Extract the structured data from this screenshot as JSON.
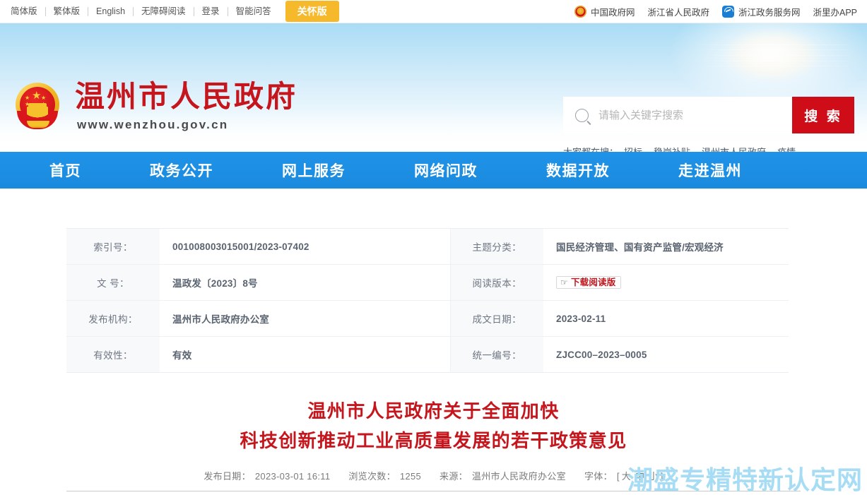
{
  "topbar": {
    "left_links": [
      {
        "label": "简体版",
        "name": "lang-simplified"
      },
      {
        "label": "繁体版",
        "name": "lang-traditional"
      },
      {
        "label": "English",
        "name": "lang-english"
      },
      {
        "label": "无障碍阅读",
        "name": "accessibility-reading"
      },
      {
        "label": "登录",
        "name": "login"
      },
      {
        "label": "智能问答",
        "name": "smart-qa"
      }
    ],
    "care_button": "关怀版",
    "right_links": [
      {
        "label": "中国政府网",
        "icon": "china-emblem-icon"
      },
      {
        "label": "浙江省人民政府",
        "icon": null
      },
      {
        "label": "浙江政务服务网",
        "icon": "zhejiang-service-icon"
      },
      {
        "label": "浙里办APP",
        "icon": null
      }
    ]
  },
  "brand": {
    "emblem_icon": "national-emblem-icon",
    "title": "温州市人民政府",
    "url": "www.wenzhou.gov.cn"
  },
  "search": {
    "icon": "search-icon",
    "placeholder": "请输入关键字搜索",
    "value": "",
    "button_label": "搜 索",
    "hot_label": "大家都在搜：",
    "hot_words": [
      "招标",
      "稳岗补贴",
      "温州市人民政府",
      "疫情"
    ],
    "accent_color": "#cf0d18"
  },
  "mainnav": {
    "accent_color": "#1f93e8",
    "items": [
      "首页",
      "政务公开",
      "网上服务",
      "网络问政",
      "数据开放",
      "走进温州"
    ]
  },
  "info_table": {
    "rows": [
      {
        "label_left": "索引号：",
        "value_left": "001008003015001/2023-07402",
        "label_right": "主题分类：",
        "value_right": "国民经济管理、国有资产监管/宏观经济"
      },
      {
        "label_left": "文 号：",
        "value_left": "温政发〔2023〕8号",
        "label_right": "阅读版本：",
        "value_right": "下载阅读版",
        "right_is_button": true,
        "right_button_icon": "hand-pointer-icon"
      },
      {
        "label_left": "发布机构：",
        "value_left": "温州市人民政府办公室",
        "label_right": "成文日期：",
        "value_right": "2023-02-11"
      },
      {
        "label_left": "有效性：",
        "value_left": "有效",
        "label_right": "统一编号：",
        "value_right": "ZJCC00–2023–0005"
      }
    ]
  },
  "document": {
    "title_line1": "温州市人民政府关于全面加快",
    "title_line2": "科技创新推动工业高质量发展的若干政策意见",
    "title_color": "#c5161d",
    "meta": {
      "publish_label": "发布日期：",
      "publish_value": "2023-03-01 16:11",
      "views_label": "浏览次数：",
      "views_value": "1255",
      "source_label": "来源：",
      "source_value": "温州市人民政府办公室",
      "fontsize_label": "字体：",
      "fontsize_open": "[",
      "fontsize_options": [
        "大",
        "中",
        "小"
      ],
      "fontsize_close": "]"
    }
  },
  "watermark": {
    "text": "潮盛专精特新认定网",
    "color": "#a7dcf5"
  }
}
